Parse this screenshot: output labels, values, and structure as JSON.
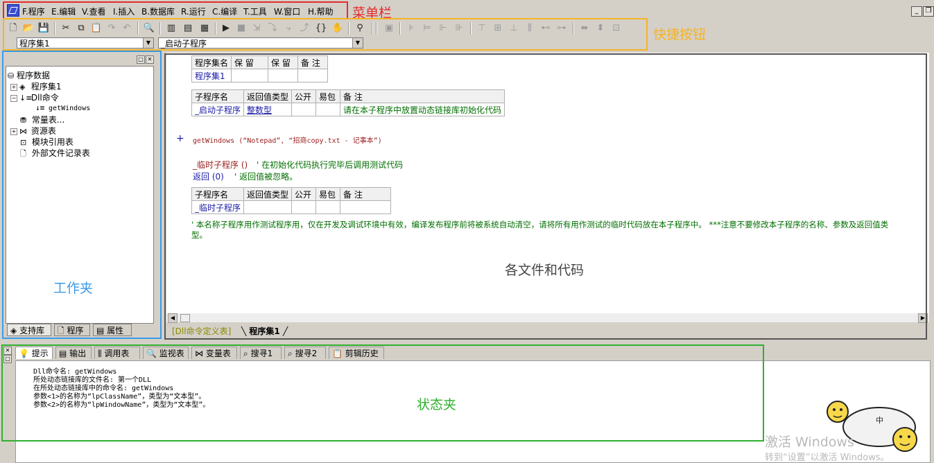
{
  "menu": {
    "items": [
      "F.程序",
      "E.编辑",
      "V.查看",
      "I.插入",
      "B.数据库",
      "R.运行",
      "C.编译",
      "T.工具",
      "W.窗口",
      "H.帮助"
    ]
  },
  "annotations": {
    "menu_label": "菜单栏",
    "toolbar_label": "快捷按钮",
    "workspace_label": "工作夹",
    "code_label": "各文件和代码",
    "status_label": "状态夹"
  },
  "combos": {
    "assembly": "程序集1",
    "subprogram": "_启动子程序"
  },
  "tree": {
    "root": "程序数据",
    "items": [
      "程序集1",
      "Dll命令",
      "getWindows",
      "常量表...",
      "资源表",
      "模块引用表",
      "外部文件记录表"
    ]
  },
  "left_tabs": [
    "支持库",
    "程序",
    "属性"
  ],
  "editor": {
    "assembly_table": {
      "headers": [
        "程序集名",
        "保 留",
        "保 留",
        "备 注"
      ],
      "row": [
        "程序集1",
        "",
        "",
        ""
      ]
    },
    "sub_table1": {
      "headers": [
        "子程序名",
        "返回值类型",
        "公开",
        "易包",
        "备 注"
      ],
      "row": [
        "_启动子程序",
        "整数型",
        "",
        "",
        "请在本子程序中放置动态链接库初始化代码"
      ]
    },
    "code_line": "getWindows (“Notepad”, “招商copy.txt - 记事本”)",
    "plus_mark": "+",
    "temp_call": "_临时子程序 ()",
    "temp_call_comment": "' 在初始化代码执行完毕后调用测试代码",
    "return_line": "返回 (0)",
    "return_comment": "' 返回值被忽略。",
    "sub_table2": {
      "headers": [
        "子程序名",
        "返回值类型",
        "公开",
        "易包",
        "备 注"
      ],
      "row": [
        "_临时子程序",
        "",
        "",
        "",
        ""
      ]
    },
    "note_line1": "' 本名称子程序用作测试程序用，仅在开发及调试环境中有效，编译发布程序前将被系统自动清空，请将所有用作测试的临时代码放在本子程序中。 ***注意不要修改本子程序的名称、参数及返回值类",
    "note_line2": "型。"
  },
  "editor_tabs": [
    "[Dll命令定义表]",
    "程序集1"
  ],
  "status_tabs": [
    "提示",
    "输出",
    "调用表",
    "监视表",
    "变量表",
    "搜寻1",
    "搜寻2",
    "剪辑历史"
  ],
  "status_lines": [
    "Dll命令名: getWindows",
    "所处动态链接库的文件名: 第一个DLL",
    "在所处动态链接库中的命令名: getWindows",
    "参数<1>的名称为“lpClassName”，类型为“文本型”。",
    "参数<2>的名称为“lpWindowName”，类型为“文本型”。"
  ],
  "watermark": {
    "line1": "激活 Windows",
    "line2": "转到“设置”以激活 Windows。"
  },
  "colors": {
    "menu_box": "#e52b2b",
    "toolbar_box": "#f5b324",
    "workspace_box": "#3b9ae8",
    "code_box": "#555555",
    "status_box": "#2fb02f"
  }
}
